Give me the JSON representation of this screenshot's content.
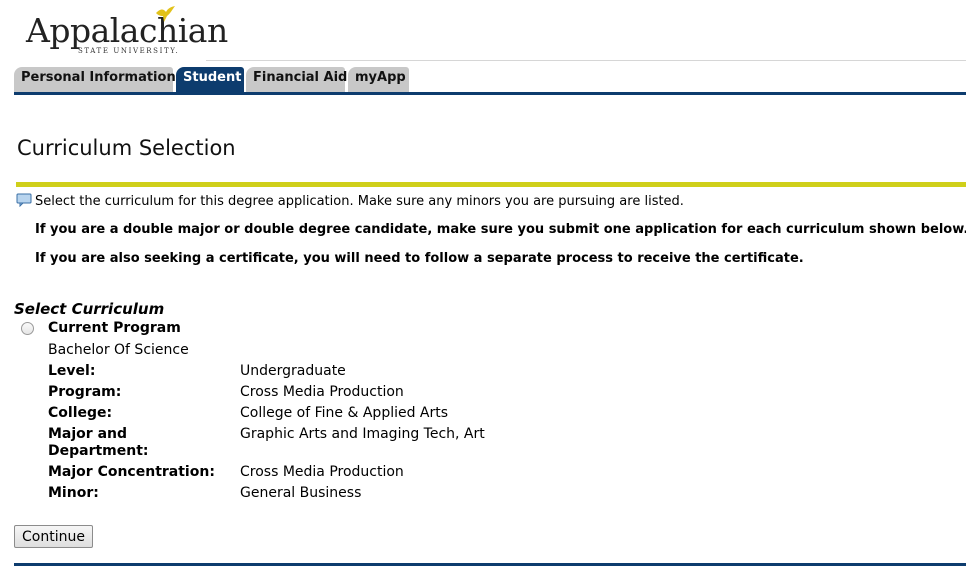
{
  "logo": {
    "name": "Appalachian",
    "subtitle": "STATE UNIVERSITY."
  },
  "tabs": [
    {
      "label": "Personal Information",
      "active": false
    },
    {
      "label": "Student",
      "active": true
    },
    {
      "label": "Financial Aid",
      "active": false
    },
    {
      "label": "myApp",
      "active": false
    }
  ],
  "page": {
    "title": "Curriculum Selection",
    "info_icon": "info-bubble-icon",
    "info_text": "Select the curriculum for this degree application. Make sure any minors you are pursuing are listed.",
    "note1": "If you are a double major or double degree candidate, make sure you submit one application for each curriculum shown below.",
    "note2": "If you are also seeking a certificate, you will need to follow a separate process to receive the certificate."
  },
  "curriculum": {
    "section_label": "Select Curriculum",
    "program_heading": "Current Program",
    "degree": "Bachelor Of Science",
    "rows": [
      {
        "label": "Level:",
        "value": "Undergraduate"
      },
      {
        "label": "Program:",
        "value": "Cross Media Production"
      },
      {
        "label": "College:",
        "value": "College of Fine & Applied Arts"
      },
      {
        "label": "Major and Department:",
        "value": "Graphic Arts and Imaging Tech, Art"
      },
      {
        "label": "Major Concentration:",
        "value": "Cross Media Production"
      },
      {
        "label": "Minor:",
        "value": "General Business"
      }
    ]
  },
  "actions": {
    "continue_label": "Continue"
  },
  "colors": {
    "brand_navy": "#0d3c6e",
    "accent_yellow": "#cfcf1a",
    "tab_gray": "#c8c8c8"
  }
}
